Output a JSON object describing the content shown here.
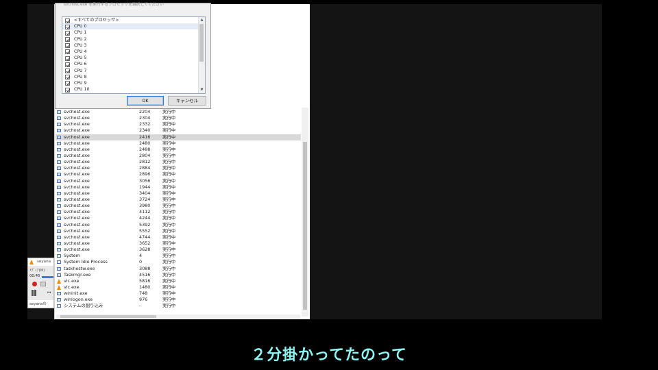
{
  "affinity_dialog": {
    "prompt": "svchost.exe を実行するプロセッサを選択してください",
    "cpus": [
      {
        "label": "<すべてのプロセッサ>",
        "checked": true
      },
      {
        "label": "CPU 0",
        "checked": true
      },
      {
        "label": "CPU 1",
        "checked": true
      },
      {
        "label": "CPU 2",
        "checked": true
      },
      {
        "label": "CPU 3",
        "checked": true
      },
      {
        "label": "CPU 4",
        "checked": true
      },
      {
        "label": "CPU 5",
        "checked": true
      },
      {
        "label": "CPU 6",
        "checked": true
      },
      {
        "label": "CPU 7",
        "checked": true
      },
      {
        "label": "CPU 8",
        "checked": true
      },
      {
        "label": "CPU 9",
        "checked": true
      },
      {
        "label": "CPU 10",
        "checked": true
      }
    ],
    "ok_label": "OK",
    "cancel_label": "キャンセル"
  },
  "processes": [
    {
      "name": "svchost.exe",
      "pid": "2204",
      "status": "実行中",
      "icon": "process-icon"
    },
    {
      "name": "svchost.exe",
      "pid": "2304",
      "status": "実行中",
      "icon": "process-icon"
    },
    {
      "name": "svchost.exe",
      "pid": "2332",
      "status": "実行中",
      "icon": "process-icon"
    },
    {
      "name": "svchost.exe",
      "pid": "2340",
      "status": "実行中",
      "icon": "process-icon"
    },
    {
      "name": "svchost.exe",
      "pid": "2416",
      "status": "実行中",
      "icon": "process-icon",
      "selected": true
    },
    {
      "name": "svchost.exe",
      "pid": "2480",
      "status": "実行中",
      "icon": "process-icon"
    },
    {
      "name": "svchost.exe",
      "pid": "2488",
      "status": "実行中",
      "icon": "process-icon"
    },
    {
      "name": "svchost.exe",
      "pid": "2804",
      "status": "実行中",
      "icon": "process-icon"
    },
    {
      "name": "svchost.exe",
      "pid": "2812",
      "status": "実行中",
      "icon": "process-icon"
    },
    {
      "name": "svchost.exe",
      "pid": "2884",
      "status": "実行中",
      "icon": "process-icon"
    },
    {
      "name": "svchost.exe",
      "pid": "2896",
      "status": "実行中",
      "icon": "process-icon"
    },
    {
      "name": "svchost.exe",
      "pid": "3056",
      "status": "実行中",
      "icon": "process-icon"
    },
    {
      "name": "svchost.exe",
      "pid": "1944",
      "status": "実行中",
      "icon": "process-icon"
    },
    {
      "name": "svchost.exe",
      "pid": "3404",
      "status": "実行中",
      "icon": "process-icon"
    },
    {
      "name": "svchost.exe",
      "pid": "3724",
      "status": "実行中",
      "icon": "process-icon"
    },
    {
      "name": "svchost.exe",
      "pid": "3980",
      "status": "実行中",
      "icon": "process-icon"
    },
    {
      "name": "svchost.exe",
      "pid": "4112",
      "status": "実行中",
      "icon": "process-icon"
    },
    {
      "name": "svchost.exe",
      "pid": "4244",
      "status": "実行中",
      "icon": "process-icon"
    },
    {
      "name": "svchost.exe",
      "pid": "5392",
      "status": "実行中",
      "icon": "process-icon"
    },
    {
      "name": "svchost.exe",
      "pid": "5552",
      "status": "実行中",
      "icon": "process-icon"
    },
    {
      "name": "svchost.exe",
      "pid": "4744",
      "status": "実行中",
      "icon": "process-icon"
    },
    {
      "name": "svchost.exe",
      "pid": "3652",
      "status": "実行中",
      "icon": "process-icon"
    },
    {
      "name": "svchost.exe",
      "pid": "3628",
      "status": "実行中",
      "icon": "process-icon"
    },
    {
      "name": "System",
      "pid": "4",
      "status": "実行中",
      "icon": "system-icon"
    },
    {
      "name": "System Idle Process",
      "pid": "0",
      "status": "実行中",
      "icon": "system-icon"
    },
    {
      "name": "taskhostw.exe",
      "pid": "3088",
      "status": "実行中",
      "icon": "process-icon"
    },
    {
      "name": "Taskmgr.exe",
      "pid": "4516",
      "status": "実行中",
      "icon": "task-manager-icon"
    },
    {
      "name": "vlc.exe",
      "pid": "5816",
      "status": "実行中",
      "icon": "vlc-icon"
    },
    {
      "name": "vlc.exe",
      "pid": "1480",
      "status": "実行中",
      "icon": "vlc-icon"
    },
    {
      "name": "wininit.exe",
      "pid": "748",
      "status": "実行中",
      "icon": "process-icon"
    },
    {
      "name": "winlogon.exe",
      "pid": "976",
      "status": "実行中",
      "icon": "process-icon"
    },
    {
      "name": "システムの割り込み",
      "pid": "-",
      "status": "実行中",
      "icon": "system-icon"
    }
  ],
  "vlc_mini": {
    "title": "seyana",
    "menu": "ﾒﾃﾞｨｱ(M)",
    "time": "00:45",
    "taskbar_label": "seyanaの"
  },
  "subtitle": "２分掛かってたのって",
  "colors": {
    "subtitle": "#8ff4f2",
    "selection": "#d9d9d9",
    "ok_border": "#2b79d7",
    "vlc_orange": "#f08a00"
  }
}
